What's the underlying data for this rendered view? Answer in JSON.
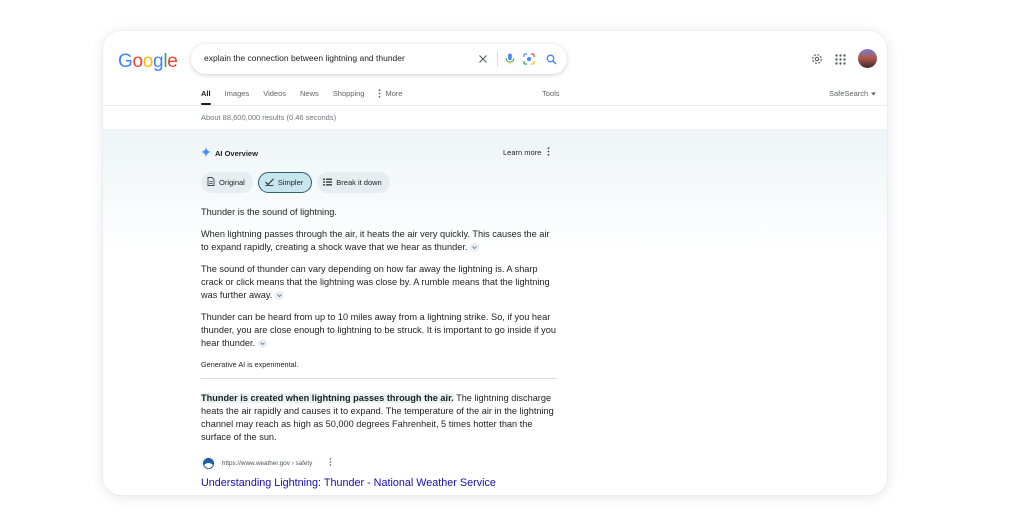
{
  "logo": {
    "letters": [
      {
        "ch": "G",
        "color": "#4285F4"
      },
      {
        "ch": "o",
        "color": "#EA4335"
      },
      {
        "ch": "o",
        "color": "#FBBC05"
      },
      {
        "ch": "g",
        "color": "#4285F4"
      },
      {
        "ch": "l",
        "color": "#34A853"
      },
      {
        "ch": "e",
        "color": "#EA4335"
      }
    ]
  },
  "search": {
    "query": "explain the connection between lightning and thunder"
  },
  "icons": {
    "clear": "close-icon",
    "voice": "microphone-icon",
    "lens": "lens-icon",
    "search": "search-icon",
    "settings": "gear-icon",
    "apps": "apps-grid-icon",
    "account": "avatar"
  },
  "tabs": [
    {
      "label": "All",
      "active": true
    },
    {
      "label": "Images"
    },
    {
      "label": "Videos"
    },
    {
      "label": "News"
    },
    {
      "label": "Shopping"
    },
    {
      "label": "More"
    }
  ],
  "tools_label": "Tools",
  "safesearch_label": "SafeSearch",
  "result_stats": "About 88,600,000 results (0.46 seconds)",
  "ai_overview": {
    "title": "AI Overview",
    "learn_more": "Learn more",
    "chips": [
      {
        "label": "Original",
        "icon": "document-icon"
      },
      {
        "label": "Simpler",
        "icon": "simplify-icon",
        "selected": true
      },
      {
        "label": "Break it down",
        "icon": "list-icon"
      }
    ],
    "paragraphs": [
      "Thunder is the sound of lightning.",
      "When lightning passes through the air, it heats the air very quickly. This causes the air to expand rapidly, creating a shock wave that we hear as thunder.",
      "The sound of thunder can vary depending on how far away the lightning is. A sharp crack or click means that the lightning was close by. A rumble means that the lightning was further away.",
      "Thunder can be heard from up to 10 miles away from a lightning strike. So, if you hear thunder, you are close enough to lightning to be struck. It is important to go inside if you hear thunder."
    ],
    "footer": "Generative AI is experimental.",
    "accent_color": "#4c8bf5"
  },
  "result": {
    "snippet_bold": "Thunder is created when lightning passes through the air.",
    "snippet_rest": " The lightning discharge heats the air rapidly and causes it to expand. The temperature of the air in the lightning channel may reach as high as 50,000 degrees Fahrenheit, 5 times hotter than the surface of the sun.",
    "source_url": "https://www.weather.gov › safety",
    "title": "Understanding Lightning: Thunder - National Weather Service",
    "link_color": "#1a0dab"
  }
}
